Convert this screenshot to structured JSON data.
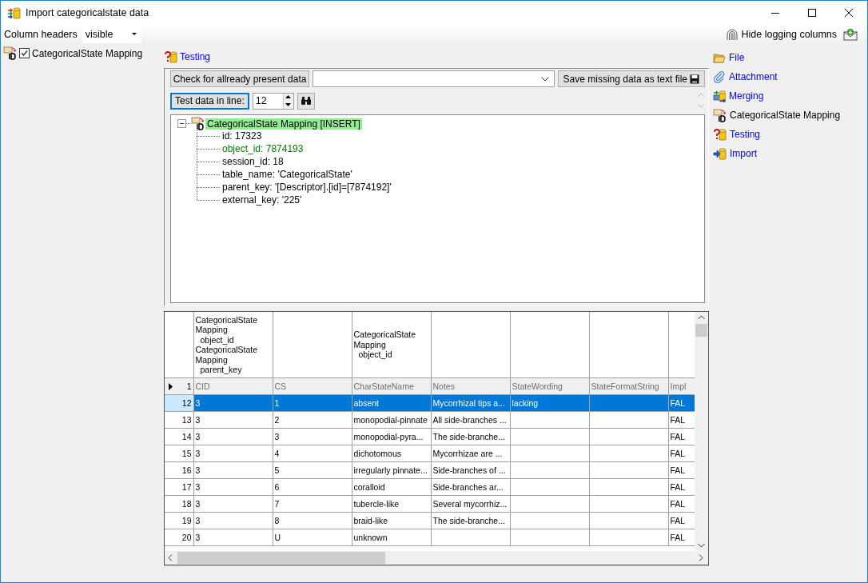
{
  "window": {
    "title": "Import categoricalstate data"
  },
  "toolbar": {
    "column_headers_label": "Column headers",
    "column_headers_value": "visible",
    "hide_logging_button": "Hide logging columns"
  },
  "tables": [
    {
      "label": "CategoricalState Mapping",
      "checked": true
    }
  ],
  "step_title": "Testing",
  "testing": {
    "check_button": "Check for allready present data",
    "save_button": "Save missing data as text file",
    "test_button": "Test data in line:",
    "line_value": "12"
  },
  "result_tree": {
    "label": "CategoricalState Mapping [INSERT]",
    "expanded": true,
    "children": [
      {
        "label": "id: 17323",
        "color": "#000000"
      },
      {
        "label": "object_id: 7874193",
        "color": "#008000"
      },
      {
        "label": "session_id: 18",
        "color": "#000000"
      },
      {
        "label": "table_name: 'CategoricalState'",
        "color": "#000000"
      },
      {
        "label": "parent_key: '[Descriptor].[id]=[7874192]'",
        "color": "#000000"
      },
      {
        "label": "external_key: '225'",
        "color": "#000000"
      }
    ]
  },
  "grid": {
    "columns": [
      {
        "name": "CID",
        "mappings": [
          {
            "table": "CategoricalState Mapping",
            "column": "object_id"
          },
          {
            "table": "CategoricalState Mapping",
            "column": "parent_key"
          }
        ]
      },
      {
        "name": "CS"
      },
      {
        "name": "CharStateName",
        "mappings": [
          {
            "table": "CategoricalState Mapping",
            "column": "object_id"
          }
        ]
      },
      {
        "name": "Notes"
      },
      {
        "name": "StateWording"
      },
      {
        "name": "StateFormatString"
      },
      {
        "name": "Impl"
      }
    ],
    "header_row": {
      "number": "1",
      "current": true
    },
    "rows": [
      {
        "number": "12",
        "selected": true,
        "cells": [
          "3",
          "1",
          "absent",
          "Mycorrhizal tips a...",
          "lacking",
          null,
          "FAL"
        ]
      },
      {
        "number": "13",
        "selected": false,
        "cells": [
          "3",
          "2",
          "monopodial-pinnate",
          "All side-branches ...",
          null,
          null,
          "FAL"
        ]
      },
      {
        "number": "14",
        "selected": false,
        "cells": [
          "3",
          "3",
          "monopodial-pyra...",
          "The side-branche...",
          null,
          null,
          "FAL"
        ]
      },
      {
        "number": "15",
        "selected": false,
        "cells": [
          "3",
          "4",
          "dichotomous",
          "Mycorrhizae are ...",
          null,
          null,
          "FAL"
        ]
      },
      {
        "number": "16",
        "selected": false,
        "cells": [
          "3",
          "5",
          "irregularly pinnate...",
          "Side-branches of ...",
          null,
          null,
          "FAL"
        ]
      },
      {
        "number": "17",
        "selected": false,
        "cells": [
          "3",
          "6",
          "coralloid",
          "Side-branches ar...",
          null,
          null,
          "FAL"
        ]
      },
      {
        "number": "18",
        "selected": false,
        "cells": [
          "3",
          "7",
          "tubercle-like",
          "Several mycorrhiz...",
          null,
          null,
          "FAL"
        ]
      },
      {
        "number": "19",
        "selected": false,
        "cells": [
          "3",
          "8",
          "braid-like",
          "The side-branche...",
          null,
          null,
          "FAL"
        ]
      },
      {
        "number": "20",
        "selected": false,
        "cells": [
          "3",
          "U",
          "unknown",
          null,
          null,
          null,
          "FAL"
        ]
      }
    ]
  },
  "steps": [
    {
      "label": "File",
      "selected": false
    },
    {
      "label": "Attachment",
      "selected": false
    },
    {
      "label": "Merging",
      "selected": false
    },
    {
      "label": "CategoricalState Mapping",
      "selected": true
    },
    {
      "label": "Testing",
      "selected": false
    },
    {
      "label": "Import",
      "selected": false
    }
  ]
}
